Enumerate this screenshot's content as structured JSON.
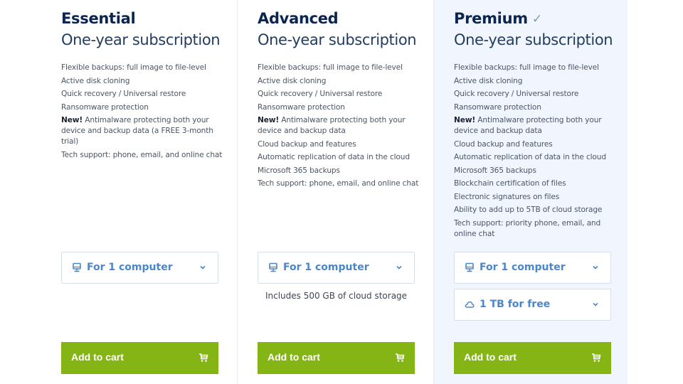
{
  "colors": {
    "accent_green": "#85b515",
    "link_blue": "#4a86c8",
    "heading_navy": "#0b2551",
    "premium_background": "#f1f6fe"
  },
  "plans": [
    {
      "name": "Essential",
      "term": "One-year subscription",
      "features": [
        {
          "text": "Flexible backups: full image to file-level"
        },
        {
          "text": "Active disk cloning"
        },
        {
          "text": "Quick recovery / Universal restore"
        },
        {
          "text": "Ransomware protection"
        },
        {
          "highlight": "New!",
          "text": " Antimalware protecting both your device and backup data (a FREE 3-month trial)"
        },
        {
          "text": "Tech support: phone, email, and online chat"
        }
      ],
      "selectors": [
        {
          "icon": "monitor-icon",
          "value": "For 1 computer"
        }
      ],
      "note": "",
      "cart_label": "Add to cart"
    },
    {
      "name": "Advanced",
      "term": "One-year subscription",
      "features": [
        {
          "text": "Flexible backups: full image to file-level"
        },
        {
          "text": "Active disk cloning"
        },
        {
          "text": "Quick recovery / Universal restore"
        },
        {
          "text": "Ransomware protection"
        },
        {
          "highlight": "New!",
          "text": " Antimalware protecting both your device and backup data"
        },
        {
          "text": "Cloud backup and features"
        },
        {
          "text": "Automatic replication of data in the cloud"
        },
        {
          "text": "Microsoft 365 backups"
        },
        {
          "text": "Tech support: phone, email, and online chat"
        }
      ],
      "selectors": [
        {
          "icon": "monitor-icon",
          "value": "For 1 computer"
        }
      ],
      "note": "Includes 500 GB of cloud storage",
      "cart_label": "Add to cart"
    },
    {
      "name": "Premium",
      "selected": true,
      "term": "One-year subscription",
      "features": [
        {
          "text": "Flexible backups: full image to file-level"
        },
        {
          "text": "Active disk cloning"
        },
        {
          "text": "Quick recovery / Universal restore"
        },
        {
          "text": "Ransomware protection"
        },
        {
          "highlight": "New!",
          "text": " Antimalware protecting both your device and backup data"
        },
        {
          "text": "Cloud backup and features"
        },
        {
          "text": "Automatic replication of data in the cloud"
        },
        {
          "text": "Microsoft 365 backups"
        },
        {
          "text": "Blockchain certification of files"
        },
        {
          "text": "Electronic signatures on files"
        },
        {
          "text": "Ability to add up to 5TB of cloud storage"
        },
        {
          "text": "Tech support: priority phone, email, and online chat"
        }
      ],
      "selectors": [
        {
          "icon": "monitor-icon",
          "value": "For 1 computer"
        },
        {
          "icon": "cloud-icon",
          "value": "1 TB for free"
        }
      ],
      "note": "",
      "cart_label": "Add to cart"
    }
  ]
}
